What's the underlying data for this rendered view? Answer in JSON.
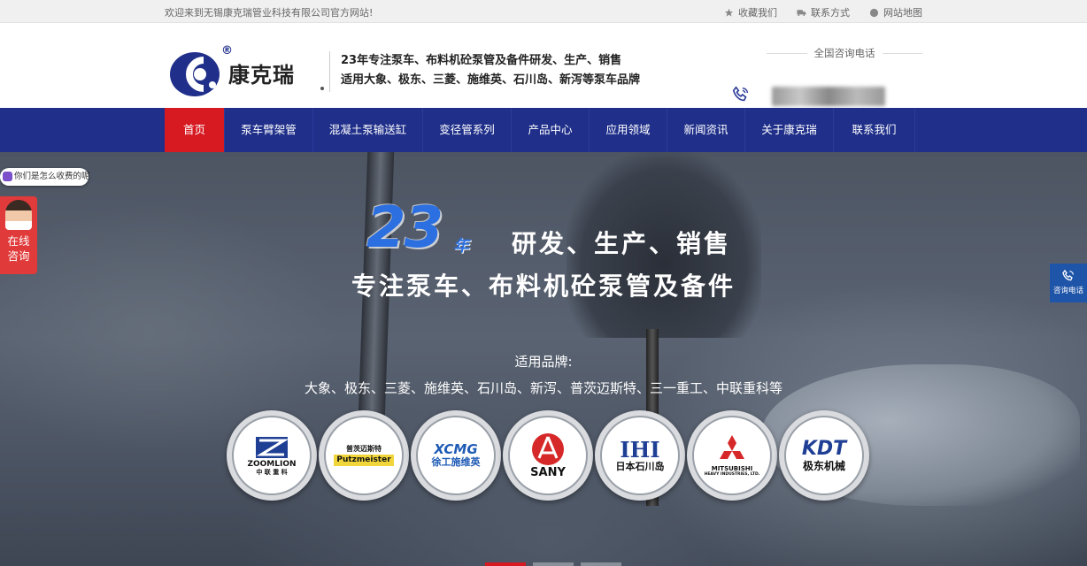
{
  "topbar": {
    "welcome": "欢迎来到无锡康克瑞管业科技有限公司官方网站!",
    "links": [
      {
        "label": "收藏我们",
        "icon": "star-icon"
      },
      {
        "label": "联系方式",
        "icon": "truck-icon"
      },
      {
        "label": "网站地图",
        "icon": "globe-icon"
      }
    ]
  },
  "header": {
    "brand": "康克瑞",
    "registered_mark": "®",
    "slogan_line1": "23年专注泵车、布料机砼泵管及备件研发、生产、销售",
    "slogan_line2": "适用大象、极东、三菱、施维英、石川岛、新泻等泵车品牌",
    "hotline_label": "全国咨询电话"
  },
  "nav": {
    "items": [
      "首页",
      "泵车臂架管",
      "混凝土泵输送缸",
      "变径管系列",
      "产品中心",
      "应用领域",
      "新闻资讯",
      "关于康克瑞",
      "联系我们"
    ],
    "active_index": 0
  },
  "hero": {
    "years": "23",
    "years_unit": "年",
    "headline1": "研发、生产、销售",
    "headline2": "专注泵车、布料机砼泵管及备件",
    "brands_label": "适用品牌:",
    "brands_list": "大象、极东、三菱、施维英、石川岛、新泻、普茨迈斯特、三一重工、中联重科等",
    "logos": [
      {
        "line1": "ZOOMLION",
        "line2": "中 联 重 科"
      },
      {
        "line1": "普茨迈斯特",
        "line2": "Putzmeister"
      },
      {
        "line1": "XCMG",
        "line2": "徐工施维英"
      },
      {
        "line1": "SANY",
        "line2": ""
      },
      {
        "line1": "IHI",
        "line2": "日本石川岛"
      },
      {
        "line1": "MITSUBISHI",
        "line2": "HEAVY INDUSTRIES, LTD."
      },
      {
        "line1": "KDT",
        "line2": "极东机械"
      }
    ]
  },
  "float_left": {
    "bubble": "你们是怎么收费的呢",
    "consult_line1": "在线",
    "consult_line2": "咨询"
  },
  "float_right": {
    "label": "咨询电话"
  },
  "colors": {
    "nav_bg": "#1f2f8a",
    "active_red": "#d71921",
    "years_blue": "#2b6fe0"
  }
}
